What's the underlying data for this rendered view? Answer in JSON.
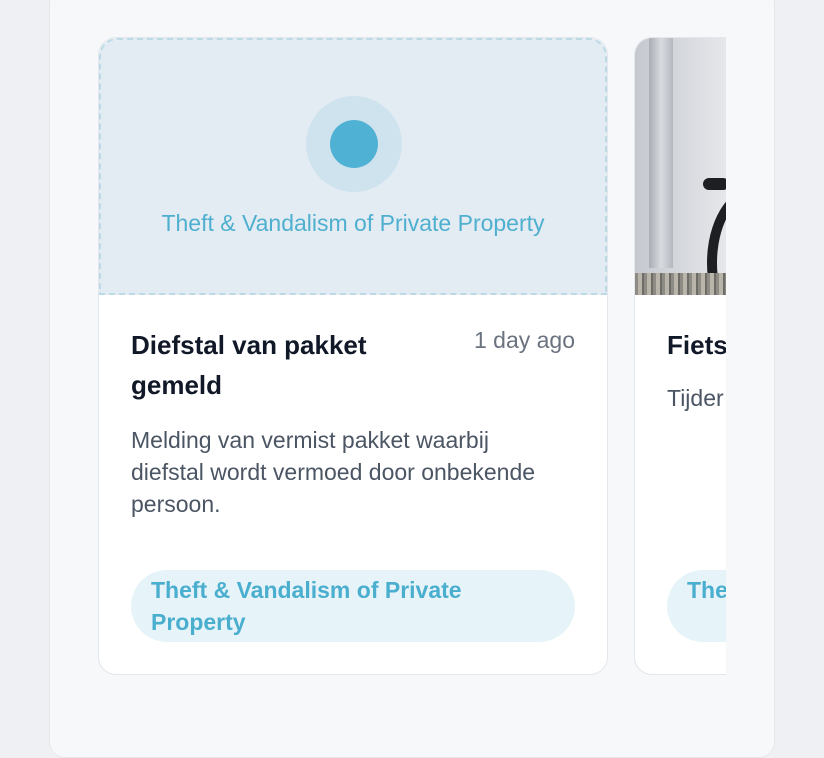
{
  "cards": [
    {
      "media_label": "Theft & Vandalism of Private Property",
      "title": "Diefstal van pakket gemeld",
      "time": "1 day ago",
      "description": "Melding van vermist pakket waarbij diefstal wordt vermoed door onbekende persoon.",
      "category": "Theft & Vandalism of Private Property"
    },
    {
      "title": "Fiets",
      "description": "Tijder werd waren zichtl plooit",
      "category": "The Pro"
    }
  ],
  "colors": {
    "accent": "#4fb1d3",
    "chip_bg": "#e6f3f8",
    "placeholder_bg": "#e4ecf3"
  },
  "icons": {
    "category_placeholder": "circle-dot-icon"
  }
}
